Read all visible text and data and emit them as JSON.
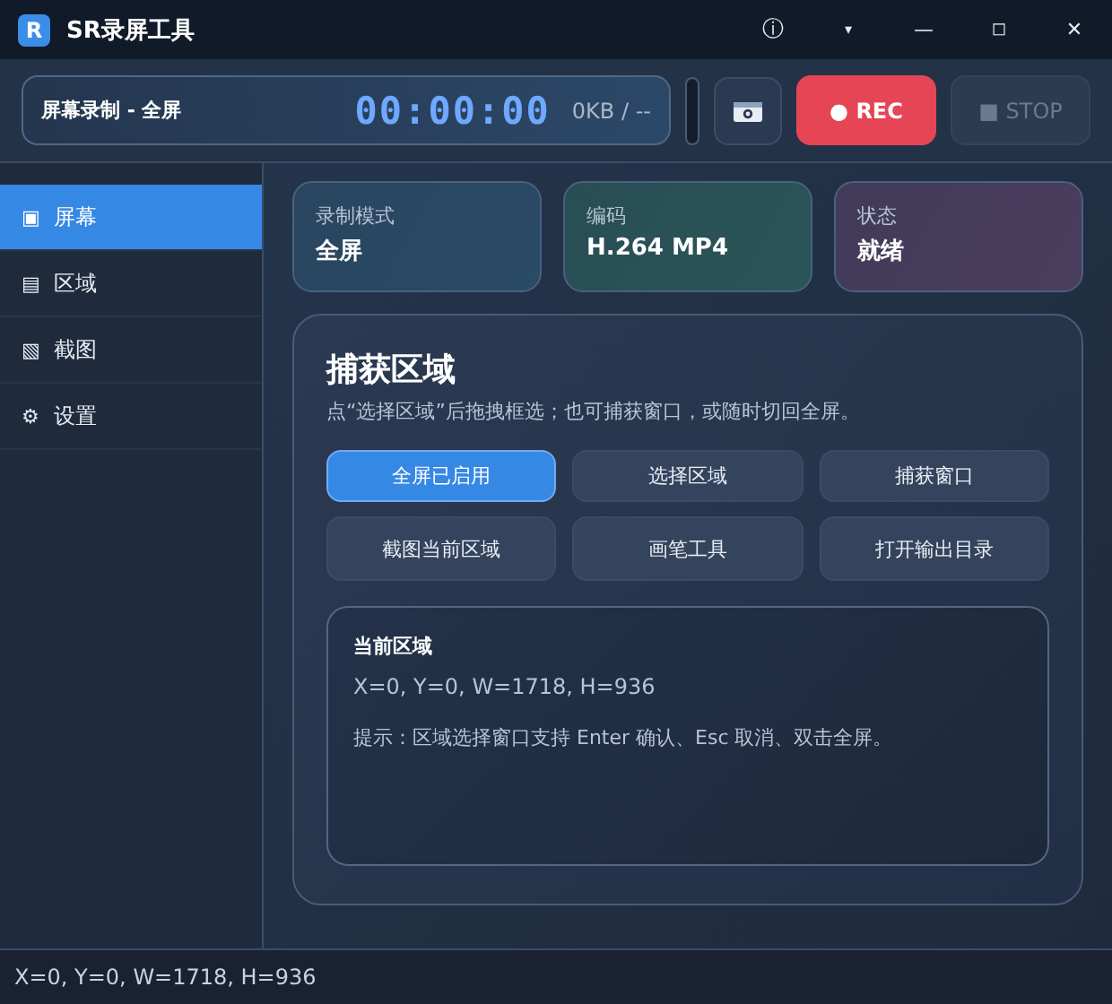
{
  "window": {
    "title": "SR录屏工具",
    "logo": "R",
    "controls": [
      {
        "kind": "info",
        "glyph": "ⓘ"
      },
      {
        "kind": "menu",
        "glyph": "▾"
      },
      {
        "kind": "minimize",
        "glyph": "—"
      },
      {
        "kind": "maximize",
        "glyph": "◻"
      },
      {
        "kind": "close",
        "glyph": "✕"
      }
    ]
  },
  "toolbar": {
    "mode_label": "屏幕录制 - 全屏",
    "timer": "00:00:00",
    "size": "0KB / --",
    "rec_button": {
      "label": "● REC",
      "disabled": false
    },
    "stop_button": {
      "label": "■ STOP",
      "disabled": true
    }
  },
  "sidebar": {
    "items": [
      {
        "icon": "▣",
        "label": "屏幕",
        "selected": true
      },
      {
        "icon": "▤",
        "label": "区域",
        "selected": false
      },
      {
        "icon": "▧",
        "label": "截图",
        "selected": false
      },
      {
        "icon": "⚙",
        "label": "设置",
        "selected": false
      }
    ]
  },
  "info_cards": [
    {
      "label": "录制模式",
      "value": "全屏",
      "color": "#2b4a66"
    },
    {
      "label": "编码",
      "value": "H.264 MP4",
      "color": "#2a5558"
    },
    {
      "label": "状态",
      "value": "就绪",
      "color": "#4a3d5e"
    }
  ],
  "capture_panel": {
    "title": "捕获区域",
    "description": "点“选择区域”后拖拽框选；也可捕获窗口，或随时切回全屏。",
    "buttons": [
      {
        "label": "全屏已启用",
        "selected": true
      },
      {
        "label": "选择区域",
        "selected": false
      },
      {
        "label": "捕获窗口",
        "selected": false
      },
      {
        "label": "截图当前区域",
        "selected": false
      },
      {
        "label": "画笔工具",
        "selected": false
      },
      {
        "label": "打开输出目录",
        "selected": false
      }
    ],
    "current_region": {
      "title": "当前区域",
      "value": "X=0, Y=0, W=1718, H=936",
      "hint": "提示：区域选择窗口支持 Enter 确认、Esc 取消、双击全屏。"
    }
  },
  "status_bar": {
    "text": "X=0, Y=0, W=1718, H=936"
  }
}
